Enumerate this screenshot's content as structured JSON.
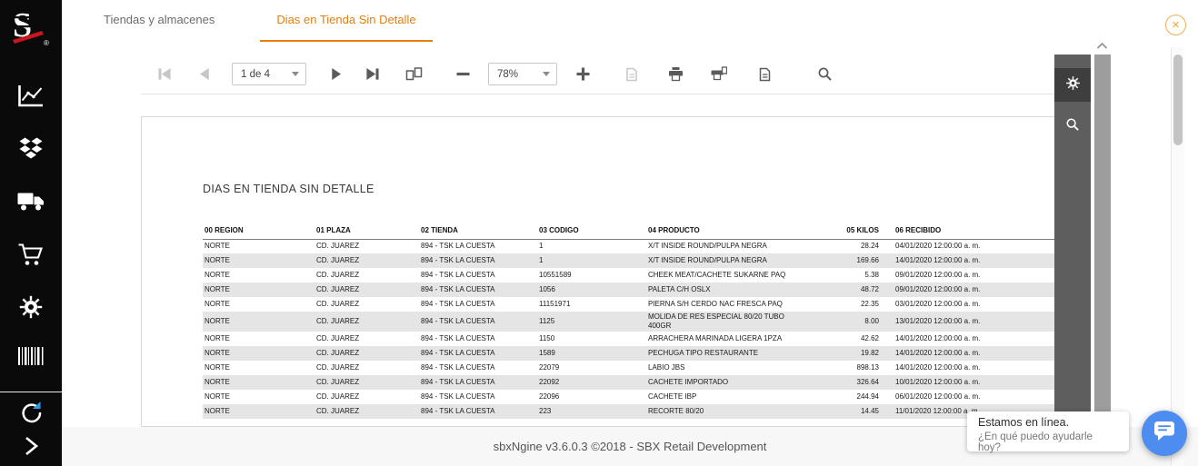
{
  "app": {
    "logo_letter": "S",
    "footer_text": "sbxNgine v3.6.0.3 ©2018 - SBX Retail Development"
  },
  "colors": {
    "accent_orange": "#e87e0d",
    "sidebar_bg": "#0a0a0a",
    "chat_blue": "#4d8df0",
    "row_stripe": "#e5e5e5",
    "side_panel_gray": "#5e5e5e",
    "logo_red": "#c8171e"
  },
  "tabs": [
    {
      "label": "Tiendas y almacenes",
      "active": false
    },
    {
      "label": "Dias en Tienda Sin Detalle",
      "active": true
    }
  ],
  "close_glyph": "×",
  "sidebar": {
    "icons": [
      "line-chart",
      "boxes",
      "truck",
      "shopping-cart",
      "gear",
      "barcode",
      "refresh",
      "chevron-right"
    ]
  },
  "toolbar": {
    "page_value": "1 de 4",
    "zoom_value": "78%",
    "icons": [
      "first-page",
      "previous-page",
      "next-page",
      "last-page",
      "multipage-view",
      "zoom-out",
      "zoom-in",
      "export-document",
      "print",
      "print-page",
      "export",
      "search"
    ]
  },
  "side_panel": {
    "icons": [
      "gear",
      "search"
    ]
  },
  "report": {
    "title": "DIAS EN TIENDA SIN DETALLE",
    "columns": [
      "00 REGION",
      "01 PLAZA",
      "02 TIENDA",
      "03 CODIGO",
      "04 PRODUCTO",
      "05 KILOS",
      "06 RECIBIDO"
    ],
    "rows": [
      [
        "NORTE",
        "CD. JUAREZ",
        "894 - TSK LA CUESTA",
        "1",
        "X/T INSIDE ROUND/PULPA NEGRA",
        "28.24",
        "04/01/2020 12:00:00 a. m."
      ],
      [
        "NORTE",
        "CD. JUAREZ",
        "894 - TSK LA CUESTA",
        "1",
        "X/T INSIDE ROUND/PULPA NEGRA",
        "169.66",
        "14/01/2020 12:00:00 a. m."
      ],
      [
        "NORTE",
        "CD. JUAREZ",
        "894 - TSK LA CUESTA",
        "10551589",
        "CHEEK MEAT/CACHETE SUKARNE PAQ",
        "5.38",
        "09/01/2020 12:00:00 a. m."
      ],
      [
        "NORTE",
        "CD. JUAREZ",
        "894 - TSK LA CUESTA",
        "1056",
        "PALETA C/H OSLX",
        "48.72",
        "09/01/2020 12:00:00 a. m."
      ],
      [
        "NORTE",
        "CD. JUAREZ",
        "894 - TSK LA CUESTA",
        "11151971",
        "PIERNA S/H CERDO NAC FRESCA PAQ",
        "22.35",
        "03/01/2020 12:00:00 a. m."
      ],
      [
        "NORTE",
        "CD. JUAREZ",
        "894 - TSK LA CUESTA",
        "1125",
        "MOLIDA DE RES ESPECIAL 80/20 TUBO 400GR",
        "8.00",
        "13/01/2020 12:00:00 a. m."
      ],
      [
        "NORTE",
        "CD. JUAREZ",
        "894 - TSK LA CUESTA",
        "1150",
        "ARRACHERA MARINADA LIGERA 1PZA",
        "42.62",
        "14/01/2020 12:00:00 a. m."
      ],
      [
        "NORTE",
        "CD. JUAREZ",
        "894 - TSK LA CUESTA",
        "1589",
        "PECHUGA TIPO RESTAURANTE",
        "19.82",
        "14/01/2020 12:00:00 a. m."
      ],
      [
        "NORTE",
        "CD. JUAREZ",
        "894 - TSK LA CUESTA",
        "22079",
        "LABIO JBS",
        "898.13",
        "14/01/2020 12:00:00 a. m."
      ],
      [
        "NORTE",
        "CD. JUAREZ",
        "894 - TSK LA CUESTA",
        "22092",
        "CACHETE IMPORTADO",
        "326.64",
        "10/01/2020 12:00:00 a. m."
      ],
      [
        "NORTE",
        "CD. JUAREZ",
        "894 - TSK LA CUESTA",
        "22096",
        "CACHETE IBP",
        "244.94",
        "06/01/2020 12:00:00 a. m."
      ],
      [
        "NORTE",
        "CD. JUAREZ",
        "894 - TSK LA CUESTA",
        "223",
        "RECORTE 80/20",
        "14.45",
        "11/01/2020 12:00:00 a. m."
      ]
    ]
  },
  "chat": {
    "status": "Estamos en línea.",
    "question": "¿En qué puedo ayudarle hoy?"
  }
}
